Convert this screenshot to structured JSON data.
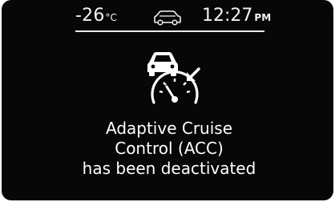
{
  "status": {
    "temperature": "-26",
    "temperature_unit": "°C",
    "vehicle_icon": "car-outline-icon",
    "time": "12:27",
    "ampm": "PM"
  },
  "warning": {
    "icon": "acc-icon",
    "message_lines": [
      "Adaptive Cruise",
      "Control (ACC)",
      "has been deactivated"
    ]
  },
  "colors": {
    "background": "#070707",
    "text": "#ffffff",
    "divider": "#e9e9e9"
  }
}
